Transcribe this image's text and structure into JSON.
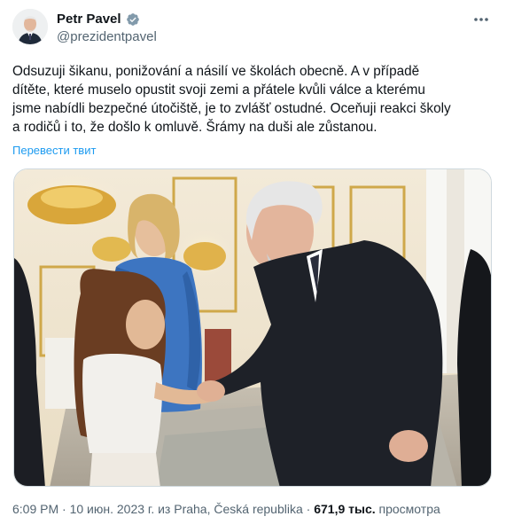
{
  "author": {
    "display_name": "Petr Pavel",
    "handle": "@prezidentpavel"
  },
  "tweet": {
    "text": "Odsuzuji šikanu, ponižování a násilí ve školách obecně. A v případě\ndítěte, které muselo opustit svoji zemi a přátele kvůli válce a kterému\njsme nabídli bezpečné útočiště, je to zvlášť ostudné. Oceňuji reakci školy\na rodičů i to, že došlo k omluvě. Šrámy na duši ale zůstanou.",
    "translate_label": "Перевести твит"
  },
  "meta": {
    "time": "6:09 PM",
    "sep1": " · ",
    "date": "10 июн. 2023 г.",
    "location": " из Praha, Česká republika",
    "sep2": " · ",
    "views_count": "671,9 тыс.",
    "views_label": " просмотра"
  },
  "icons": {
    "verified": "verified-badge-icon",
    "more": "more-horizontal-icon"
  },
  "colors": {
    "accent": "#1d9bf0",
    "secondary_text": "#536471",
    "primary_text": "#0f1419",
    "verified_badge": "#829aab"
  }
}
